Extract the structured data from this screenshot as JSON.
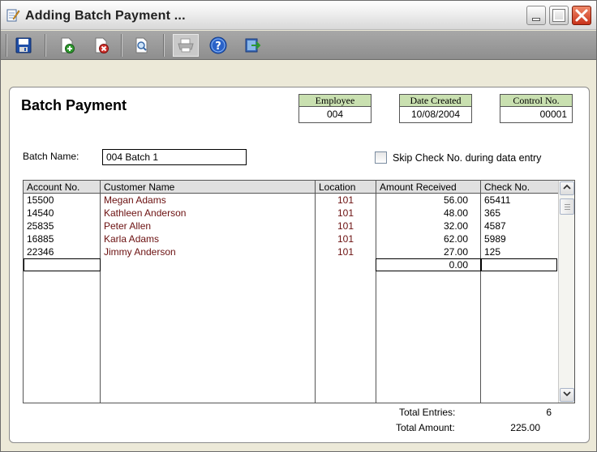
{
  "window": {
    "title": "Adding Batch Payment ..."
  },
  "form": {
    "heading": "Batch Payment",
    "employee": {
      "label": "Employee",
      "value": "004"
    },
    "date_created": {
      "label": "Date Created",
      "value": "10/08/2004"
    },
    "control_no": {
      "label": "Control No.",
      "value": "00001"
    },
    "batch_name_label": "Batch Name:",
    "batch_name_value": "004 Batch 1",
    "skip_check_label": "Skip Check No. during data entry",
    "skip_check_checked": false
  },
  "grid": {
    "columns": [
      "Account No.",
      "Customer Name",
      "Location",
      "Amount Received",
      "Check No."
    ],
    "rows": [
      {
        "account": "15500",
        "customer": "Megan Adams",
        "location": "101",
        "amount": "56.00",
        "check": "65411"
      },
      {
        "account": "14540",
        "customer": "Kathleen Anderson",
        "location": "101",
        "amount": "48.00",
        "check": "365"
      },
      {
        "account": "25835",
        "customer": "Peter Allen",
        "location": "101",
        "amount": "32.00",
        "check": "4587"
      },
      {
        "account": "16885",
        "customer": "Karla Adams",
        "location": "101",
        "amount": "62.00",
        "check": "5989"
      },
      {
        "account": "22346",
        "customer": "Jimmy Anderson",
        "location": "101",
        "amount": "27.00",
        "check": "125"
      }
    ],
    "new_row": {
      "amount": "0.00"
    }
  },
  "totals": {
    "entries_label": "Total Entries:",
    "entries_value": "6",
    "amount_label": "Total Amount:",
    "amount_value": "225.00"
  }
}
